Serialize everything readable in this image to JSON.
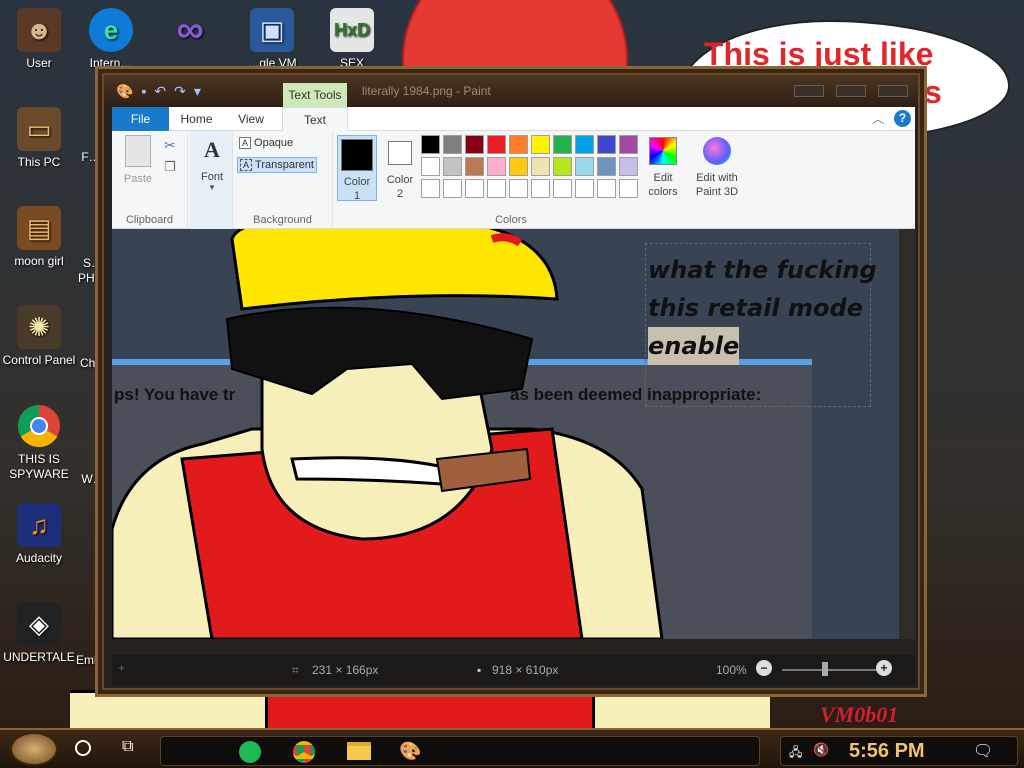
{
  "desktop": {
    "icons_left": [
      {
        "label": "User",
        "icon": "user-icon"
      },
      {
        "label": "This PC",
        "icon": "computer-icon"
      },
      {
        "label": "moon girl",
        "icon": "folder-icon"
      },
      {
        "label": "Control Panel",
        "icon": "control-panel-icon"
      },
      {
        "label": "THIS IS SPYWARE",
        "icon": "chrome-icon"
      },
      {
        "label": "Audacity",
        "icon": "audacity-icon"
      },
      {
        "label": "UNDERTALE",
        "icon": "unity-icon"
      }
    ],
    "icons_col2": [
      {
        "label": "Intern… Ex…",
        "icon": "edge-icon"
      },
      {
        "label": "F…",
        "icon": "app-icon"
      },
      {
        "label": "S… PHO…",
        "icon": "app-icon"
      },
      {
        "label": "Ch…",
        "icon": "app-icon"
      },
      {
        "label": "W…",
        "icon": "app-icon"
      },
      {
        "label": "Emb…",
        "icon": "app-icon"
      }
    ],
    "icons_top": [
      {
        "label": "…gle VM",
        "icon": "virtualbox-icon"
      },
      {
        "label": "SEX",
        "icon": "hxd-icon"
      }
    ],
    "bubble_text": "This is just like",
    "bubble_text2": "s",
    "watermark": "VM0b01"
  },
  "paint": {
    "title": "literally 1984.png - Paint",
    "context_tab": "Text Tools",
    "tabs": [
      "File",
      "Home",
      "View",
      "Text"
    ],
    "clipboard": {
      "paste": "Paste",
      "label": "Clipboard"
    },
    "font": {
      "label": "Font",
      "glyph": "A"
    },
    "background": {
      "opaque": "Opaque",
      "transparent": "Transparent",
      "label": "Background"
    },
    "colors": {
      "color1": "Color 1",
      "color2": "Color 2",
      "edit_colors": "Edit colors",
      "edit_3d": "Edit with Paint 3D",
      "label": "Colors",
      "color1_value": "#000000",
      "color2_value": "#ffffff",
      "palette_row1": [
        "#000000",
        "#7f7f7f",
        "#880015",
        "#ed1c24",
        "#ff7f27",
        "#fff200",
        "#22b14c",
        "#00a2e8",
        "#3f48cc",
        "#a349a4"
      ],
      "palette_row2": [
        "#ffffff",
        "#c3c3c3",
        "#b97a57",
        "#ffaec9",
        "#ffc90e",
        "#efe4b0",
        "#b5e61d",
        "#99d9ea",
        "#7092be",
        "#c8bfe7"
      ]
    },
    "canvas": {
      "caption": "ps! You have tr",
      "caption2": "as been deemed inappropriate:",
      "text_box_line1": "what the fucking",
      "text_box_line2": "this retail mode",
      "text_box_line3": "enable"
    },
    "status": {
      "cursor_pos": "231 × 166px",
      "size": "918 × 610px",
      "zoom": "100%"
    }
  },
  "taskbar": {
    "time": "5:56 PM"
  }
}
